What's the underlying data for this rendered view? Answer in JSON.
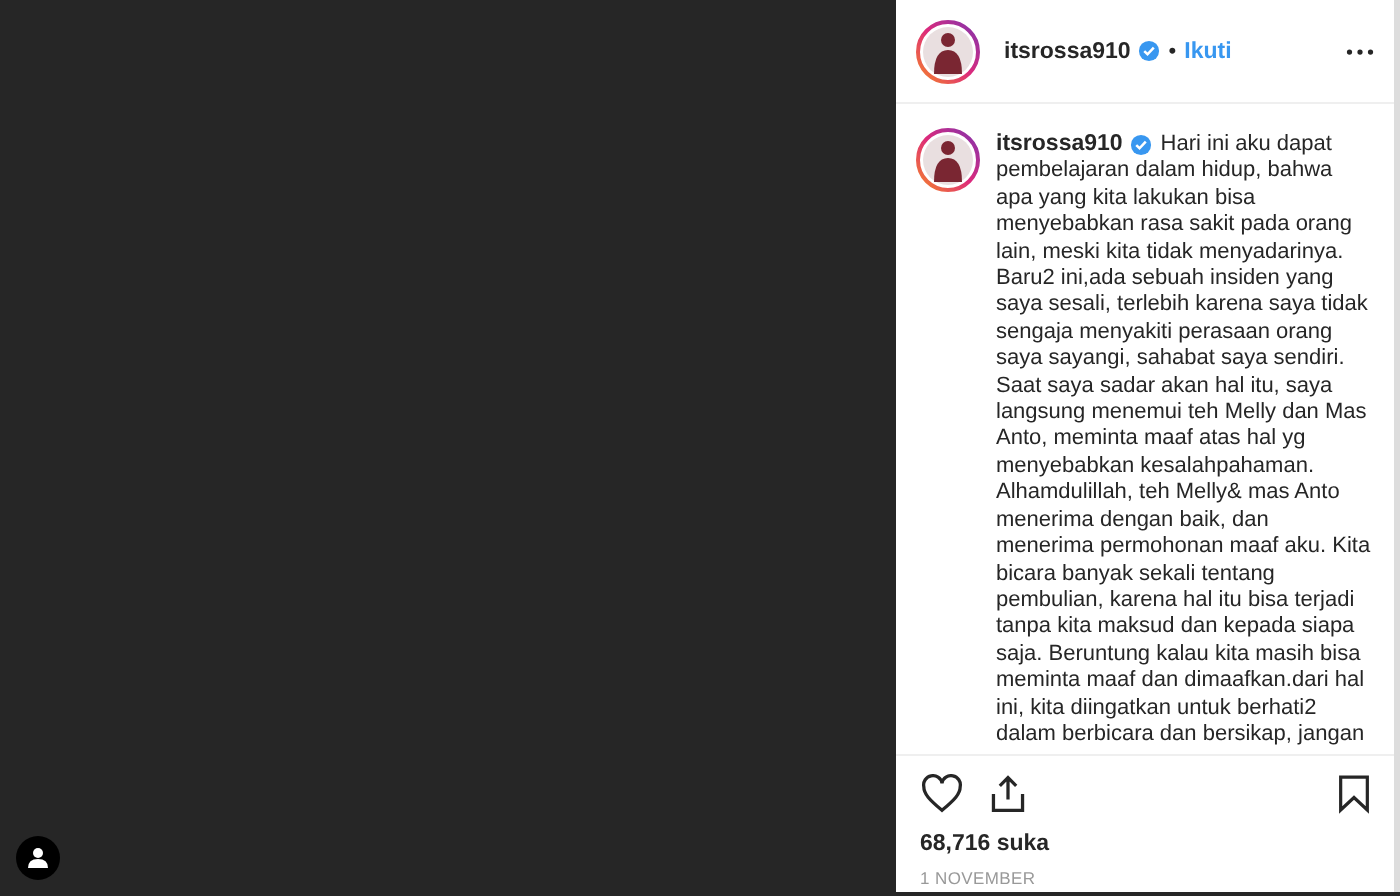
{
  "post": {
    "header": {
      "username": "itsrossa910",
      "verified": true,
      "separator": "•",
      "follow": "Ikuti"
    },
    "caption": {
      "username": "itsrossa910",
      "verified": true,
      "lead": "Hari ini aku dapat",
      "text": "pembelajaran dalam hidup, bahwa\napa yang kita lakukan bisa\nmenyebabkan rasa sakit pada orang\nlain, meski kita tidak menyadarinya.\nBaru2 ini,ada sebuah insiden yang\nsaya sesali, terlebih karena saya tidak\nsengaja menyakiti perasaan orang\nsaya sayangi, sahabat saya sendiri.\nSaat saya sadar akan hal itu, saya\nlangsung menemui teh Melly dan Mas\nAnto, meminta maaf atas hal yg\nmenyebabkan kesalahpahaman.\nAlhamdulillah, teh Melly& mas Anto\nmenerima dengan baik, dan\nmenerima permohonan maaf aku. Kita\nbicara banyak sekali tentang\npembulian, karena hal itu bisa terjadi\ntanpa kita maksud dan kepada siapa\nsaja. Beruntung kalau kita masih bisa\nmeminta maaf dan dimaafkan.dari hal\nini, kita diingatkan untuk berhati2\ndalam berbicara dan bersikap, jangan"
    },
    "likes": "68,716 suka",
    "date": "1 NOVEMBER",
    "liked": false,
    "saved": false
  }
}
